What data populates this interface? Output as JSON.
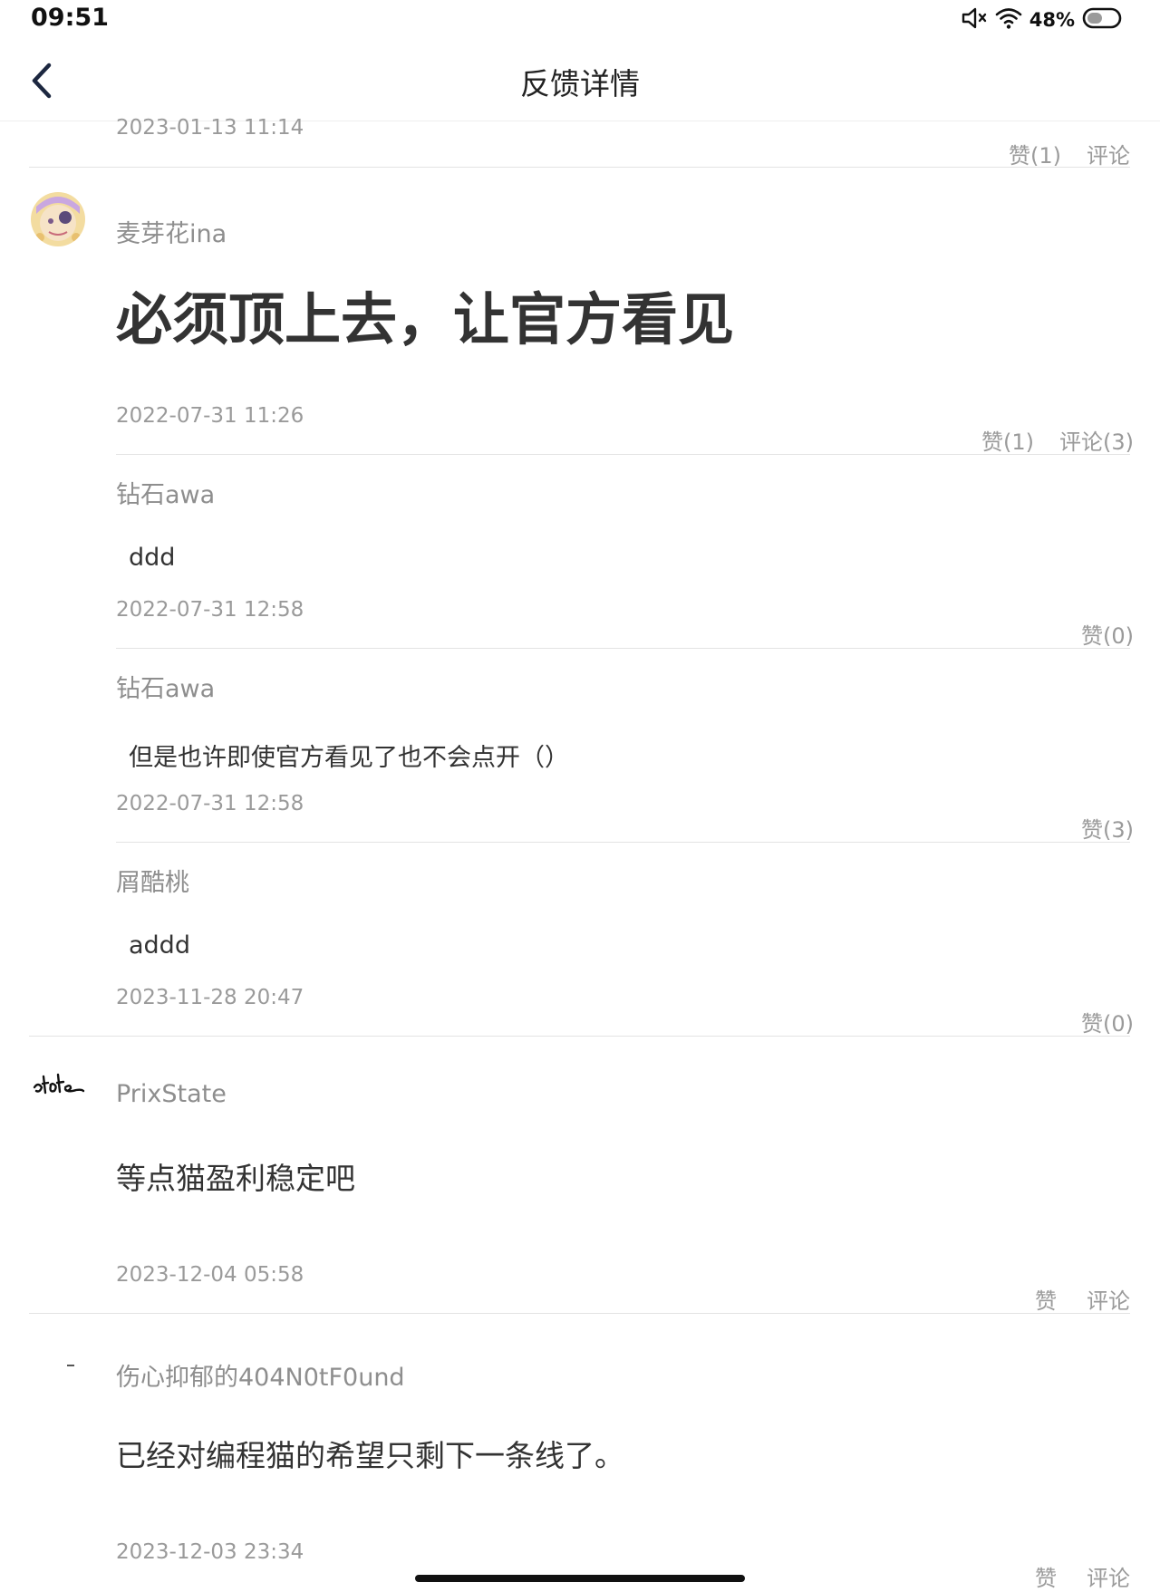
{
  "status_bar": {
    "time": "09:51",
    "battery": "48%",
    "icons": [
      "mute-icon",
      "wifi-icon",
      "battery-icon"
    ]
  },
  "nav": {
    "title": "反馈详情",
    "back_icon": "back-chevron-icon"
  },
  "top_partial": {
    "date": "2023-01-13 11:14",
    "like": "赞(1)",
    "comment": "评论"
  },
  "posts": [
    {
      "username": "麦芽花ina",
      "body": "必须顶上去，让官方看见",
      "date": "2022-07-31 11:26",
      "like": "赞(1)",
      "comment": "评论(3)",
      "replies": [
        {
          "username": "钻石awa",
          "body": "ddd",
          "date": "2022-07-31 12:58",
          "like": "赞(0)"
        },
        {
          "username": "钻石awa",
          "body": "但是也许即使官方看见了也不会点开（）",
          "date": "2022-07-31 12:58",
          "like": "赞(3)"
        },
        {
          "username": "屑酷桃",
          "body": "addd",
          "date": "2023-11-28 20:47",
          "like": "赞(0)"
        }
      ]
    },
    {
      "username": "PrixState",
      "body": "等点猫盈利稳定吧",
      "date": "2023-12-04 05:58",
      "like": "赞",
      "comment": "评论"
    },
    {
      "username": "伤心抑郁的404N0tF0und",
      "body": "已经对编程猫的希望只剩下一条线了。",
      "date": "2023-12-03 23:34",
      "like": "赞",
      "comment": "评论"
    }
  ],
  "colors": {
    "nav_icon": "#1c2740",
    "meta_text": "#9a9a9a",
    "divider": "#e3e3e3"
  }
}
